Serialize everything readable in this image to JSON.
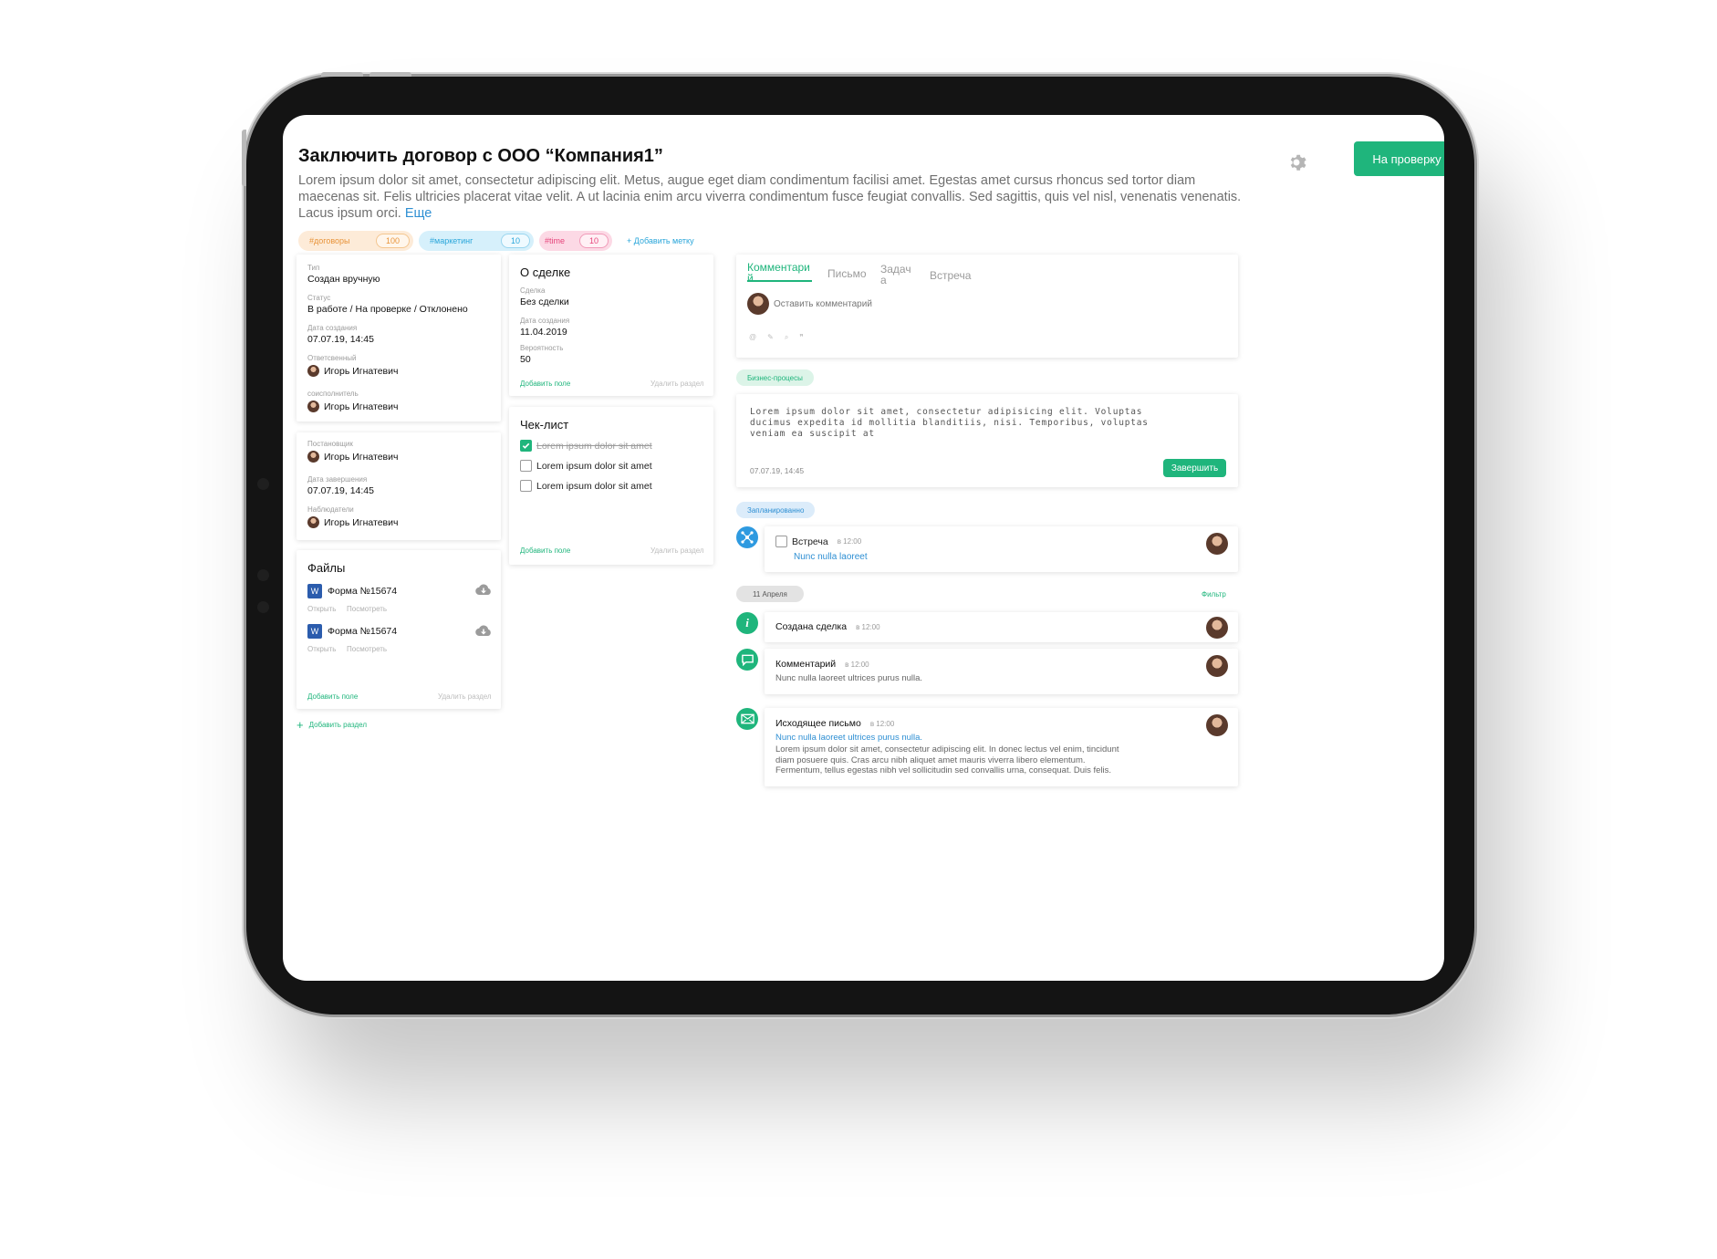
{
  "header": {
    "title": "Заключить договор с ООО “Компания1”",
    "description": "Lorem ipsum dolor sit amet, consectetur adipiscing elit. Metus, augue eget diam condimentum facilisi amet. Egestas amet cursus rhoncus sed tortor diam maecenas sit. Felis ultricies placerat vitae velit. A ut lacinia enim arcu viverra condimentum fusce feugiat convallis. Sed sagittis, quis vel nisl, venenatis venenatis. Lacus ipsum orci.",
    "more_label": "Еще",
    "review_button": "На проверку",
    "tags": [
      {
        "label": "#договоры",
        "count": "100"
      },
      {
        "label": "#маркетинг",
        "count": "10"
      },
      {
        "label": "#time",
        "count": "10"
      }
    ],
    "add_tag": "+ Добавить метку"
  },
  "info_card": {
    "type_label": "Тип",
    "type_value": "Создан вручную",
    "status_label": "Статус",
    "status_value": "В работе / На проверке / Отклонено",
    "created_label": "Дата создания",
    "created_value": "07.07.19, 14:45",
    "responsible_label": "Ответсвенный",
    "responsible_value": "Игорь Игнатевич",
    "coexec_label": "соисполнитель",
    "coexec_value": "Игорь Игнатевич"
  },
  "people_card": {
    "setter_label": "Постановщик",
    "setter_value": "Игорь Игнатевич",
    "end_label": "Дата завершения",
    "end_value": "07.07.19, 14:45",
    "watchers_label": "Наблюдатели",
    "watchers_value": "Игорь Игнатевич"
  },
  "files_card": {
    "title": "Файлы",
    "files": [
      {
        "name": "Форма №15674",
        "open": "Открыть",
        "view": "Посмотреть"
      },
      {
        "name": "Форма №15674",
        "open": "Открыть",
        "view": "Посмотреть"
      }
    ],
    "add_field": "Добавить поле",
    "delete_section": "Удалить раздел"
  },
  "add_section": "Добавить раздел",
  "deal_card": {
    "title": "О сделке",
    "deal_label": "Сделка",
    "deal_value": "Без сделки",
    "created_label": "Дата создания",
    "created_value": "11.04.2019",
    "prob_label": "Вероятность",
    "prob_value": "50",
    "add_field": "Добавить поле",
    "delete_section": "Удалить раздел"
  },
  "checklist_card": {
    "title": "Чек-лист",
    "items": [
      {
        "text": "Lorem ipsum dolor sit amet",
        "done": true
      },
      {
        "text": "Lorem ipsum dolor sit amet",
        "done": false
      },
      {
        "text": "Lorem ipsum dolor sit amet",
        "done": false
      }
    ],
    "add_field": "Добавить поле",
    "delete_section": "Удалить раздел"
  },
  "activity": {
    "tabs": [
      "Комментари й",
      "Письмо",
      "Задач а",
      "Встреча"
    ],
    "comment_placeholder": "Оставить комментарий",
    "toolbar_icons": [
      "mention-icon",
      "pencil-icon",
      "attach-icon",
      "quote-icon"
    ]
  },
  "business": {
    "pill": "Бизнес-процесы",
    "text": "Lorem ipsum dolor sit amet, consectetur adipisicing elit. Voluptas ducimus expedita id mollitia blanditiis, nisi. Temporibus, voluptas veniam ea suscipit at",
    "date": "07.07.19, 14:45",
    "finish_button": "Завершить"
  },
  "planned": {
    "pill": "Запланированно",
    "title": "Встреча",
    "time": "в 12:00",
    "link": "Nunc nulla laoreet"
  },
  "history": {
    "date_pill": "11 Апреля",
    "filter": "Фильтр",
    "deal_created": "Создана сделка",
    "deal_time": "в 12:00",
    "comment_title": "Комментарий",
    "comment_time": "в 12:00",
    "comment_text": "Nunc nulla laoreet ultrices purus nulla.",
    "mail_title": "Исходящее письмо",
    "mail_time": "в 12:00",
    "mail_subject": "Nunc nulla laoreet ultrices purus nulla.",
    "mail_body": "Lorem ipsum dolor sit amet, consectetur adipiscing elit. In donec lectus vel enim, tincidunt diam posuere quis. Cras arcu nibh aliquet amet mauris viverra libero elementum. Fermentum, tellus egestas nibh vel sollicitudin sed convallis urna, consequat. Duis felis."
  },
  "colors": {
    "accent": "#1fb57c",
    "link": "#2e8fd3"
  }
}
